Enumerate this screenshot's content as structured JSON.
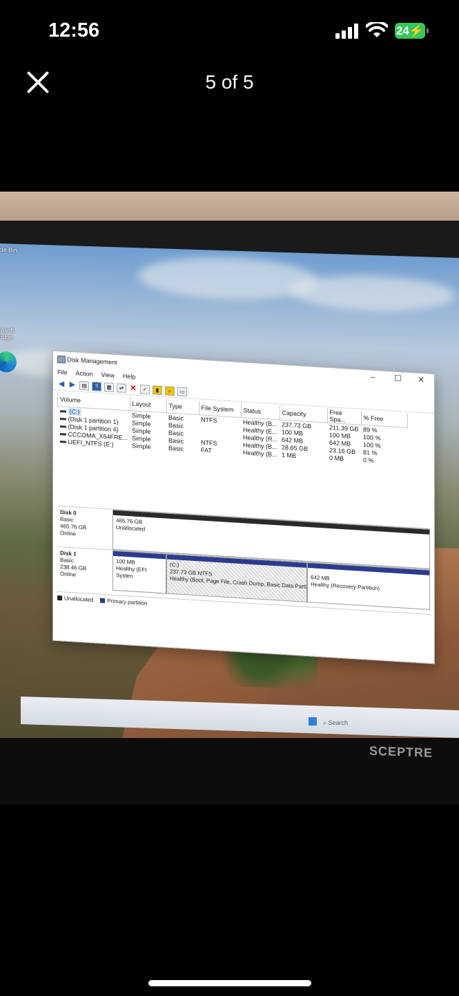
{
  "status_bar": {
    "time": "12:56",
    "battery": "24"
  },
  "viewer": {
    "counter": "5 of 5"
  },
  "photo": {
    "desktop_icons": [
      {
        "label": "cle Bin"
      },
      {
        "label": "rosoft"
      },
      {
        "label": "Edge"
      }
    ],
    "taskbar_search": "Search",
    "monitor_brand": "SCEPTRE",
    "disk_management": {
      "title": "Disk Management",
      "menu": [
        "File",
        "Action",
        "View",
        "Help"
      ],
      "columns": [
        "Volume",
        "Layout",
        "Type",
        "File System",
        "Status",
        "Capacity",
        "Free Spa...",
        "% Free"
      ],
      "volumes": [
        {
          "volume": "(C:)",
          "layout": "Simple",
          "type": "Basic",
          "fs": "NTFS",
          "status": "Healthy (B...",
          "capacity": "237.73 GB",
          "free": "211.39 GB",
          "pct": "89 %"
        },
        {
          "volume": "(Disk 1 partition 1)",
          "layout": "Simple",
          "type": "Basic",
          "fs": "",
          "status": "Healthy (E...",
          "capacity": "100 MB",
          "free": "100 MB",
          "pct": "100 %"
        },
        {
          "volume": "(Disk 1 partition 4)",
          "layout": "Simple",
          "type": "Basic",
          "fs": "",
          "status": "Healthy (R...",
          "capacity": "642 MB",
          "free": "642 MB",
          "pct": "100 %"
        },
        {
          "volume": "CCCOMA_X64FRE...",
          "layout": "Simple",
          "type": "Basic",
          "fs": "NTFS",
          "status": "Healthy (B...",
          "capacity": "28.65 GB",
          "free": "23.16 GB",
          "pct": "81 %"
        },
        {
          "volume": "UEFI_NTFS (E:)",
          "layout": "Simple",
          "type": "Basic",
          "fs": "FAT",
          "status": "Healthy (B...",
          "capacity": "1 MB",
          "free": "0 MB",
          "pct": "0 %"
        }
      ],
      "disk0": {
        "name": "Disk 0",
        "type": "Basic",
        "size": "465.76 GB",
        "state": "Online",
        "unallocated_size": "465.76 GB",
        "unallocated_label": "Unallocated"
      },
      "disk1": {
        "name": "Disk 1",
        "type": "Basic",
        "size": "238.46 GB",
        "state": "Online",
        "p1_size": "100 MB",
        "p1_status": "Healthy (EFI Systen",
        "p2_name": "(C:)",
        "p2_size": "237.73 GB NTFS",
        "p2_status": "Healthy (Boot, Page File, Crash Dump, Basic Data Partitic",
        "p3_size": "642 MB",
        "p3_status": "Healthy (Recovery Partition)"
      },
      "legend": [
        "Unallocated",
        "Primary partition"
      ]
    }
  }
}
